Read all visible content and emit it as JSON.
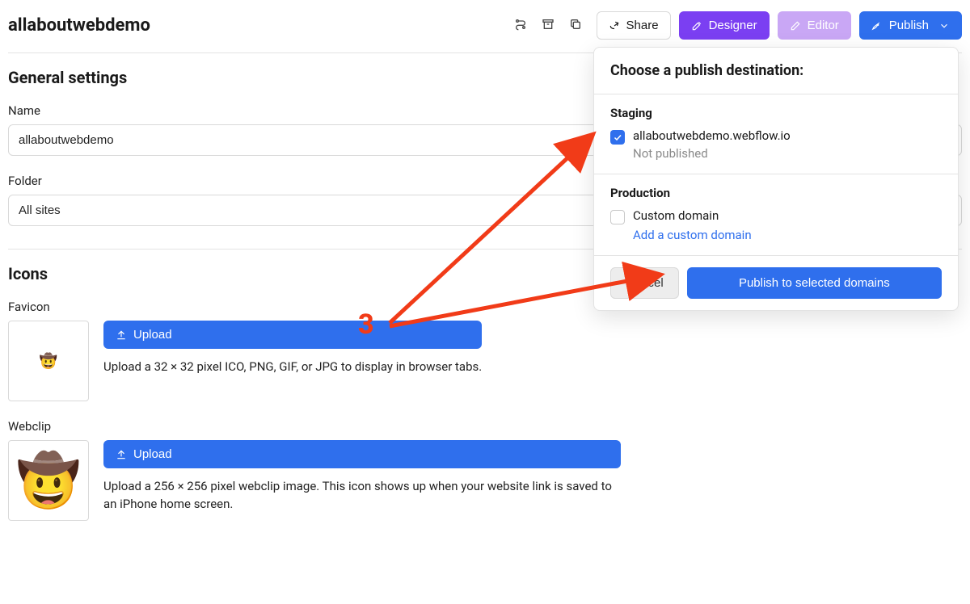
{
  "header": {
    "site_title": "allaboutwebdemo",
    "share_label": "Share",
    "designer_label": "Designer",
    "editor_label": "Editor",
    "publish_label": "Publish"
  },
  "general": {
    "heading": "General settings",
    "name_label": "Name",
    "name_value": "allaboutwebdemo",
    "folder_label": "Folder",
    "folder_value": "All sites"
  },
  "icons_section": {
    "heading": "Icons",
    "favicon": {
      "label": "Favicon",
      "upload_label": "Upload",
      "helper": "Upload a 32 × 32 pixel ICO, PNG, GIF, or JPG to display in browser tabs.",
      "emoji": "🤠"
    },
    "webclip": {
      "label": "Webclip",
      "upload_label": "Upload",
      "helper": "Upload a 256 × 256 pixel webclip image. This icon shows up when your website link is saved to an iPhone home screen.",
      "emoji": "🤠"
    }
  },
  "publish_popover": {
    "title": "Choose a publish destination:",
    "staging_heading": "Staging",
    "staging_domain": "allaboutwebdemo.webflow.io",
    "staging_status": "Not published",
    "production_heading": "Production",
    "production_label": "Custom domain",
    "add_domain_link": "Add a custom domain",
    "cancel_label": "Cancel",
    "publish_btn_label": "Publish to selected domains"
  },
  "annotation": {
    "step_number": "3"
  }
}
